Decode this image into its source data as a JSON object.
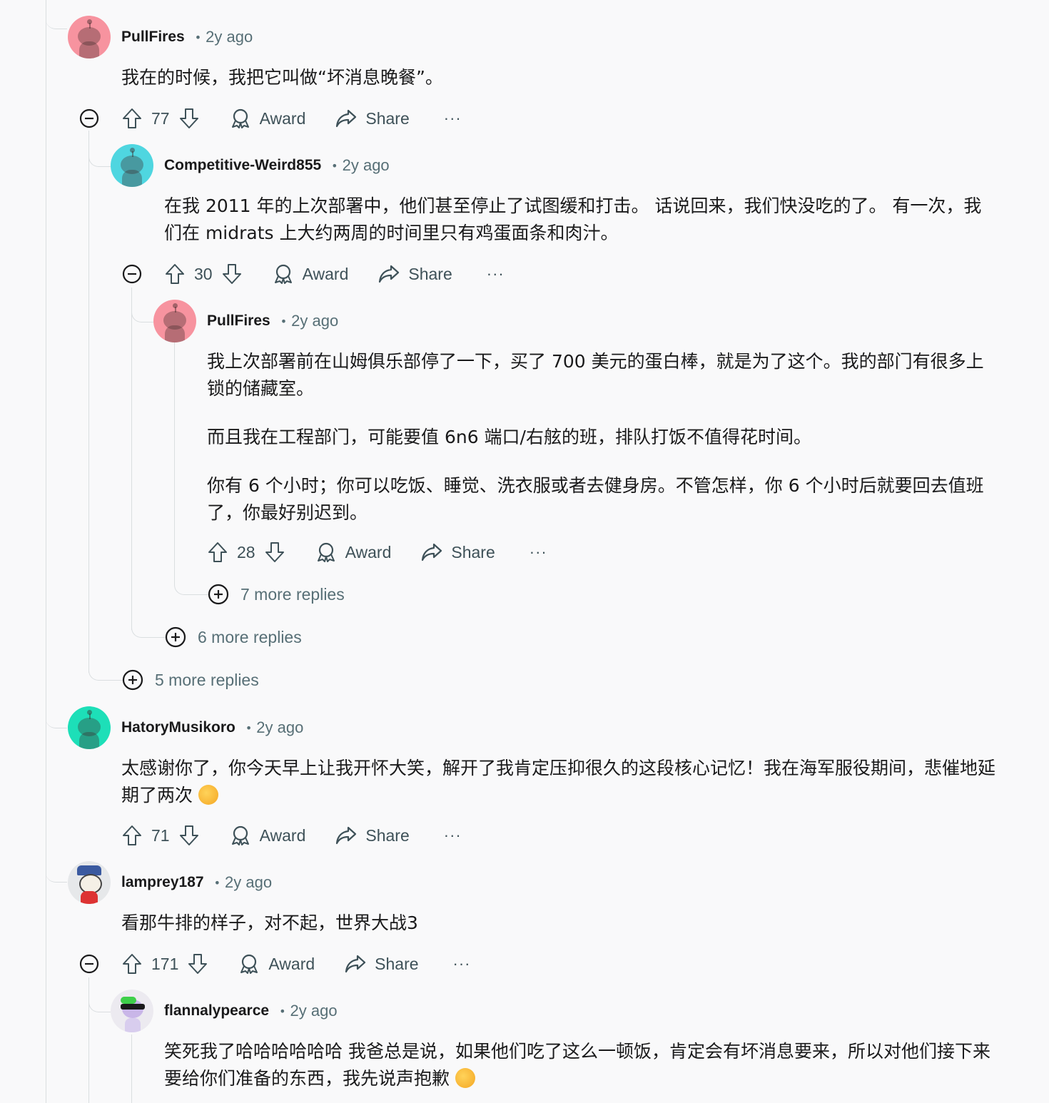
{
  "comments": [
    {
      "user": "PullFires",
      "time": "2y ago",
      "body": [
        "我在的时候，我把它叫做“坏消息晚餐”。"
      ],
      "score": "77"
    },
    {
      "user": "Competitive-Weird855",
      "time": "2y ago",
      "body": [
        "在我 2011 年的上次部署中，他们甚至停止了试图缓和打击。 话说回来，我们快没吃的了。 有一次，我们在 midrats 上大约两周的时间里只有鸡蛋面条和肉汁。"
      ],
      "score": "30"
    },
    {
      "user": "PullFires",
      "time": "2y ago",
      "body": [
        "我上次部署前在山姆俱乐部停了一下，买了 700 美元的蛋白棒，就是为了这个。我的部门有很多上锁的储藏室。",
        "而且我在工程部门，可能要值 6n6 端口/右舷的班，排队打饭不值得花时间。",
        "你有 6 个小时；你可以吃饭、睡觉、洗衣服或者去健身房。不管怎样，你 6 个小时后就要回去值班了，你最好别迟到。"
      ],
      "score": "28"
    },
    {
      "user": "HatoryMusikoro",
      "time": "2y ago",
      "body": [
        "太感谢你了，你今天早上让我开怀大笑，解开了我肯定压抑很久的这段核心记忆！我在海军服役期间，悲催地延期了两次"
      ],
      "score": "71"
    },
    {
      "user": "lamprey187",
      "time": "2y ago",
      "body": [
        "看那牛排的样子，对不起，世界大战3"
      ],
      "score": "171"
    },
    {
      "user": "flannalypearce",
      "time": "2y ago",
      "body": [
        "笑死我了哈哈哈哈哈哈 我爸总是说，如果他们吃了这么一顿饭，肯定会有坏消息要来，所以对他们接下来要给你们准备的东西，我先说声抱歉"
      ]
    }
  ],
  "labels": {
    "award": "Award",
    "share": "Share",
    "more": "···",
    "dot": "•"
  },
  "more_replies": [
    "7 more replies",
    "6 more replies",
    "5 more replies"
  ],
  "icons": [
    "upvote-icon",
    "downvote-icon",
    "award-icon",
    "share-icon",
    "collapse-icon",
    "expand-icon",
    "overflow-icon"
  ],
  "colors": {
    "background": "#f9f9fa",
    "meta": "#576f76",
    "thread_line": "#dadee0"
  }
}
